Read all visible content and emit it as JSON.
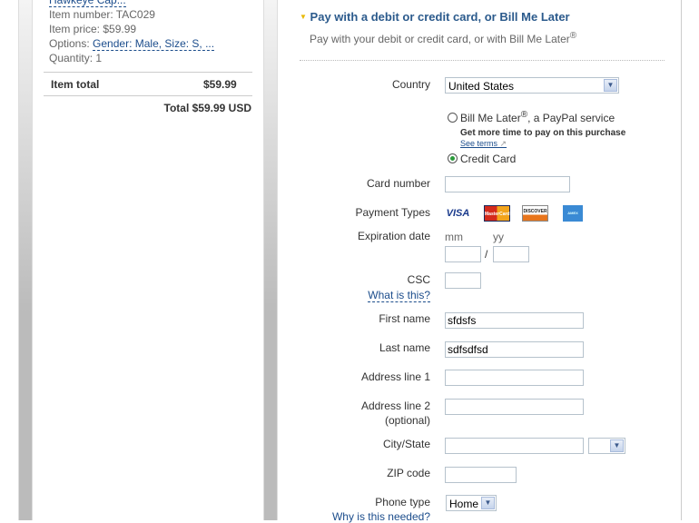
{
  "cart": {
    "item_name": "Hawkeye Cap...",
    "item_number": "Item number: TAC029",
    "item_price": "Item price: $59.99",
    "options_label": "Options:",
    "options_value": "Gender: Male, Size: S, ...",
    "quantity": "Quantity: 1",
    "item_total_label": "Item total",
    "item_total_value": "$59.99",
    "total": "Total $59.99 USD"
  },
  "payment": {
    "heading": "Pay with a debit or credit card, or Bill Me Later",
    "subheading": "Pay with your debit or credit card, or with Bill Me Later",
    "reg": "®"
  },
  "form": {
    "country_label": "Country",
    "country_value": "United States",
    "bml_label": "Bill Me Later",
    "bml_suffix": ", a PayPal service",
    "bml_promo": "Get more time to pay on this purchase",
    "see_terms": "See terms",
    "cc_label": "Credit Card",
    "card_number_label": "Card number",
    "card_number_value": "",
    "payment_types_label": "Payment Types",
    "card_types": [
      "VISA",
      "MasterCard",
      "DISCOVER",
      "AMEX"
    ],
    "exp_label": "Expiration date",
    "mm": "mm",
    "yy": "yy",
    "slash": "/",
    "csc_label": "CSC",
    "csc_help": "What is this?",
    "first_name_label": "First name",
    "first_name_value": "sfdsfs",
    "last_name_label": "Last name",
    "last_name_value": "sdfsdfsd",
    "addr1_label": "Address line 1",
    "addr2_label": "Address line 2",
    "optional": "(optional)",
    "city_label": "City/State",
    "zip_label": "ZIP code",
    "phone_type_label": "Phone type",
    "phone_type_value": "Home",
    "phone_help": "Why is this needed?"
  }
}
